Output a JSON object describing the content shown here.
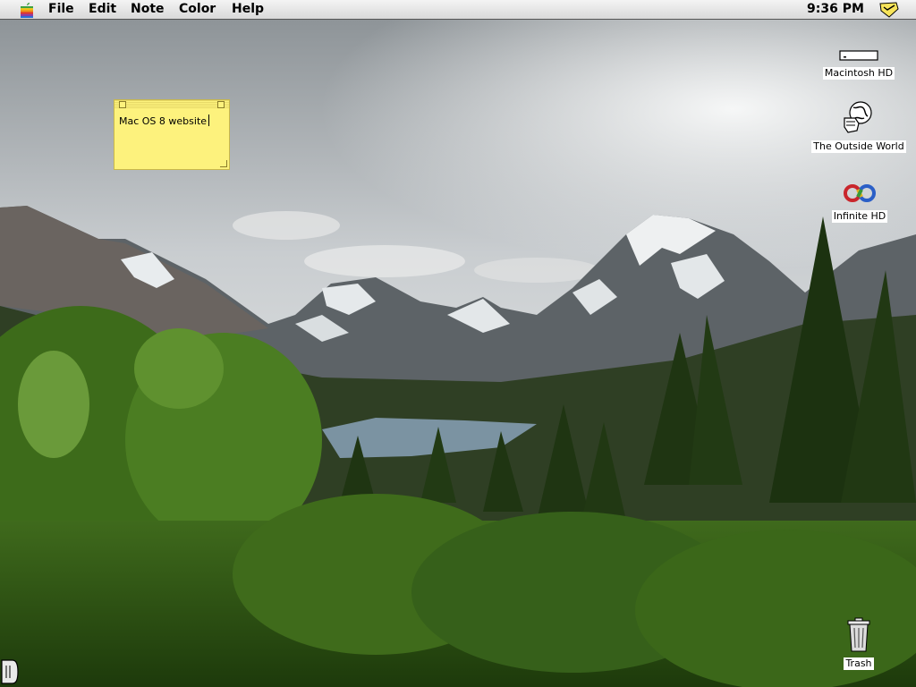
{
  "menubar": {
    "apple_icon": "rainbow-apple-icon",
    "menus": [
      "File",
      "Edit",
      "Note",
      "Color",
      "Help"
    ],
    "clock": "9:36 PM",
    "app_icon": "stickies-app-icon"
  },
  "sticky_note": {
    "text": "Mac OS 8 website",
    "color": "#fdf27d"
  },
  "desktop_icons": [
    {
      "label": "Macintosh HD",
      "icon": "hard-drive-icon"
    },
    {
      "label": "The Outside World",
      "icon": "globe-hand-icon"
    },
    {
      "label": "Infinite HD",
      "icon": "infinity-disk-icon"
    },
    {
      "label": "Trash",
      "icon": "trash-icon"
    }
  ],
  "desktop": {
    "wallpaper": "mountain-lake-forest-photo"
  }
}
